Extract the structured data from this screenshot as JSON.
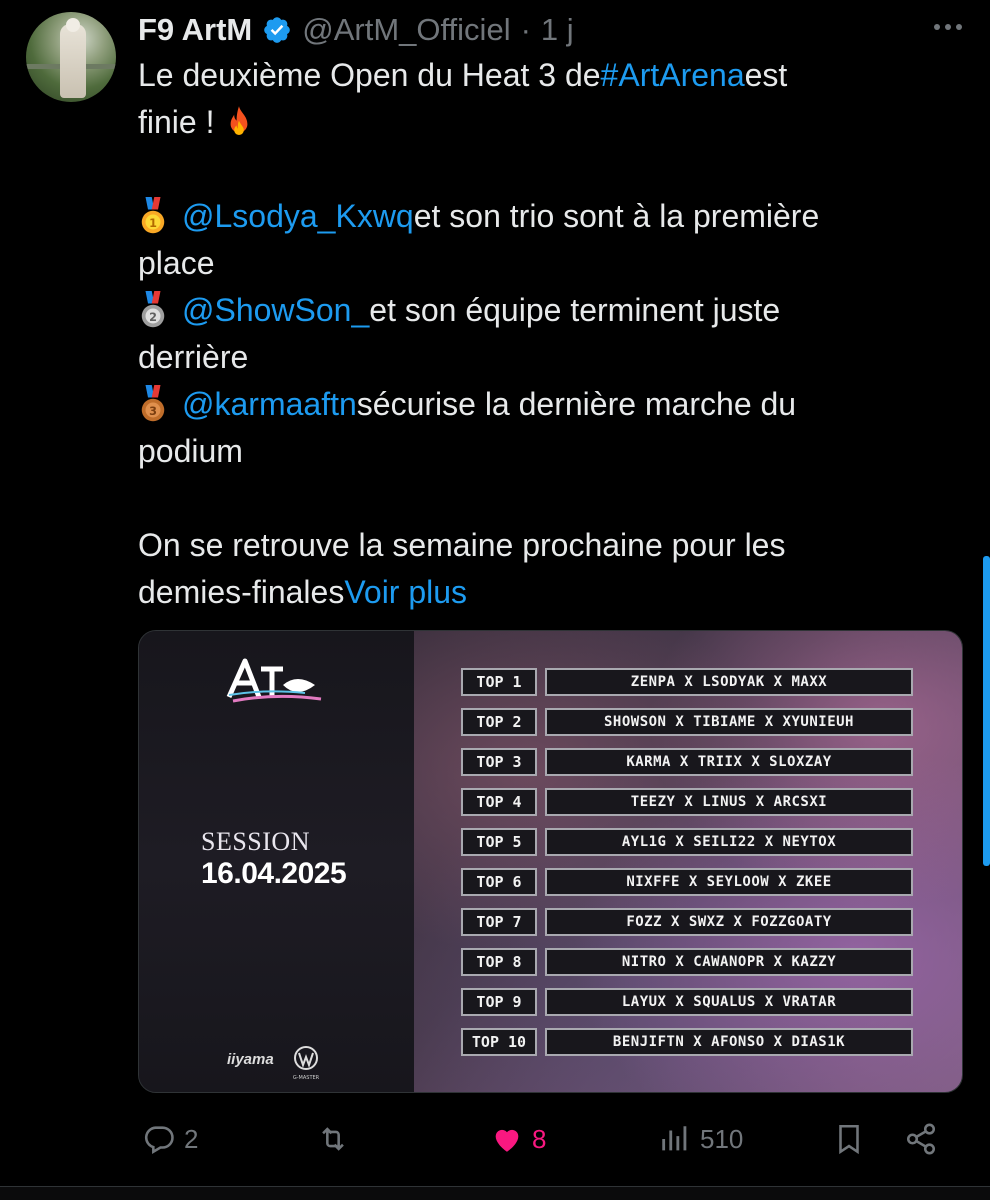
{
  "tweet": {
    "display_name": "F9 ArtM",
    "handle": "@ArtM_Officiel",
    "separator": "·",
    "time": "1 j",
    "lines": {
      "l1_pre": "Le deuxième Open du Heat 3 de ",
      "l1_tag": "#ArtArena",
      "l1_post": " est",
      "l2": "finie !",
      "l3_mention": "@Lsodya_Kxwq",
      "l3_post": " et son trio sont à la première",
      "l4": "place",
      "l5_mention": "@ShowSon_",
      "l5_post": " et son équipe terminent juste",
      "l6": "derrière",
      "l7_mention": "@karmaaftn",
      "l7_post": " sécurise la dernière marche du",
      "l8": "podium",
      "l9": "On se retrouve la semaine prochaine pour les",
      "l10_pre": "demies-finales ",
      "l10_more": "Voir plus"
    }
  },
  "media": {
    "logo_text": "ART ARENA",
    "session_label": "SESSION",
    "session_date": "16.04.2025",
    "sponsor_1": "iiyama",
    "sponsor_2": "G-MASTER",
    "ranking": [
      {
        "rank": "TOP 1",
        "team": "ZENPA X LSODYAK X MAXX"
      },
      {
        "rank": "TOP 2",
        "team": "SHOWSON X TIBIAME X XYUNIEUH"
      },
      {
        "rank": "TOP 3",
        "team": "KARMA X TRIIX X SLOXZAY"
      },
      {
        "rank": "TOP 4",
        "team": "TEEZY X LINUS X ARCSXI"
      },
      {
        "rank": "TOP 5",
        "team": "AYL1G X SEILI22 X NEYTOX"
      },
      {
        "rank": "TOP 6",
        "team": "NIXFFE X SEYLOOW X ZKEE"
      },
      {
        "rank": "TOP 7",
        "team": "FOZZ X SWXZ X FOZZGOATY"
      },
      {
        "rank": "TOP 8",
        "team": "NITRO X CAWANOPR X KAZZY"
      },
      {
        "rank": "TOP 9",
        "team": "LAYUX X SQUALUS X VRATAR"
      },
      {
        "rank": "TOP 10",
        "team": "BENJIFTN X AFONSO X DIAS1K"
      }
    ]
  },
  "actions": {
    "replies": "2",
    "likes": "8",
    "views": "510"
  },
  "icons": {
    "verified": "verified-badge-icon",
    "reply": "reply-icon",
    "retweet": "retweet-icon",
    "like": "heart-icon",
    "views": "views-icon",
    "bookmark": "bookmark-icon",
    "share": "share-icon"
  },
  "colors": {
    "background": "#000000",
    "text": "#e7e9ea",
    "muted": "#71767b",
    "link": "#1d9bf0",
    "like": "#f91880"
  }
}
